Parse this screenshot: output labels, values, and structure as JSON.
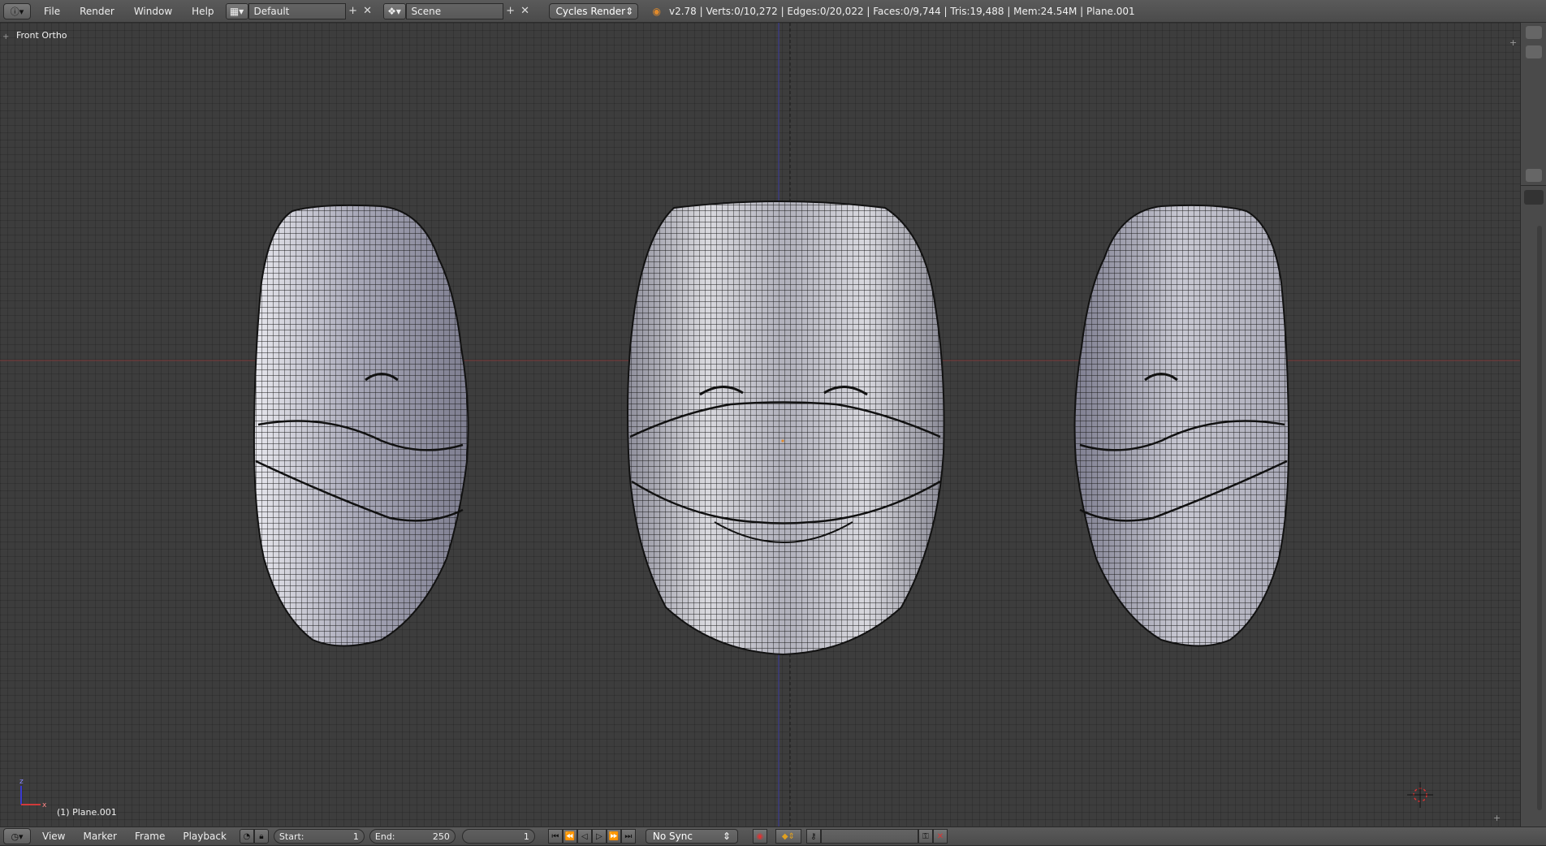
{
  "topbar": {
    "editor_icon": "info-icon",
    "menus": [
      "File",
      "Render",
      "Window",
      "Help"
    ],
    "layout_name": "Default",
    "scene_name": "Scene",
    "render_engine": "Cycles Render",
    "stats": "v2.78 | Verts:0/10,272 | Edges:0/20,022 | Faces:0/9,744 | Tris:19,488 | Mem:24.54M | Plane.001"
  },
  "viewport": {
    "view_name": "Front Ortho",
    "object_label": "(1) Plane.001",
    "models": [
      "mask-left-side-view",
      "mask-front-view",
      "mask-right-side-view"
    ]
  },
  "timeline": {
    "menus": [
      "View",
      "Marker",
      "Frame",
      "Playback"
    ],
    "start_label": "Start:",
    "start_value": "1",
    "end_label": "End:",
    "end_value": "250",
    "current_frame": "1",
    "sync_mode": "No Sync"
  },
  "colors": {
    "header_bg": "#4d4d4d",
    "viewport_bg": "#3d3d3d",
    "x_axis": "#8c3a3a",
    "z_axis": "#3a3a8c"
  }
}
